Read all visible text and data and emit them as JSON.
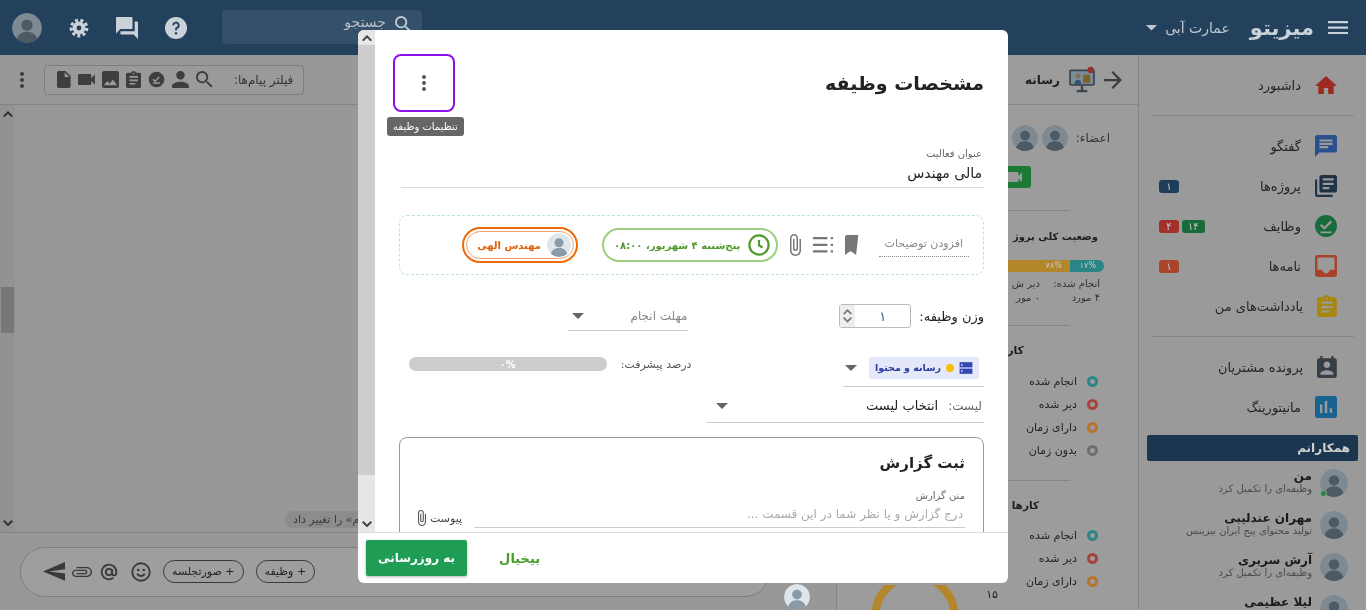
{
  "topbar": {
    "logo": "میزیتو",
    "workspace": "عمارت آبی",
    "search_placeholder": "جستجو"
  },
  "sidebar": {
    "groups": [
      [
        {
          "kind": "home",
          "label": "داشبورد"
        }
      ],
      [
        {
          "kind": "chat",
          "label": "گفتگو"
        },
        {
          "kind": "projects",
          "label": "پروژه‌ها",
          "badges": [
            {
              "text": "۱",
              "color": "#1e3d5a"
            }
          ]
        },
        {
          "kind": "tasks",
          "label": "وظایف",
          "badges": [
            {
              "text": "۱۴",
              "color": "#1a6b3c"
            },
            {
              "text": "۴",
              "color": "#a3302a"
            }
          ]
        },
        {
          "kind": "letters",
          "label": "نامه‌ها",
          "badges": [
            {
              "text": "۱",
              "color": "#a8452a"
            }
          ]
        },
        {
          "kind": "notes",
          "label": "یادداشت‌های من"
        }
      ],
      [
        {
          "kind": "customers",
          "label": "پرونده مشتریان"
        },
        {
          "kind": "monitoring",
          "label": "مانیتورینگ"
        }
      ]
    ],
    "colleagues_heading": "همکارانم",
    "colleagues": [
      {
        "name": "من",
        "status": "وظیفه‌ای را تکمیل کرد",
        "online": true
      },
      {
        "name": "مهران عندلیبی",
        "status": "تولید محتوای پیج ایران بیزینس",
        "online": false
      },
      {
        "name": "آرش سریری",
        "status": "وظیفه‌ای را تکمیل کرد",
        "online": false
      },
      {
        "name": "لیلا عظیمی",
        "online": false
      }
    ]
  },
  "project": {
    "title": "رسانه",
    "members_label": "اعضاء:",
    "status_heading": "وضعیت کلی پروژ",
    "progress": [
      {
        "label": "۱۷%",
        "color": "#2a8686"
      },
      {
        "label": "۷۸%",
        "color": "#b3862c"
      }
    ],
    "stats": [
      {
        "label": "انجام شده:",
        "value": "۴ مورد"
      },
      {
        "label": "دیر ش",
        "value": "۰ مور"
      }
    ],
    "sections": [
      {
        "heading": "کار",
        "legend": [
          {
            "label": "انجام شده",
            "color": "#2a8686"
          },
          {
            "label": "دیر شده",
            "color": "#a6423e"
          },
          {
            "label": "دارای زمان",
            "color": "#b8752a"
          },
          {
            "label": "بدون زمان",
            "color": "#6e6e6e"
          }
        ]
      },
      {
        "heading": "کارها",
        "legend": [
          {
            "label": "انجام شده",
            "color": "#2a8686"
          },
          {
            "label": "دیر شده",
            "color": "#a6423e"
          },
          {
            "label": "دارای زمان",
            "color": "#b8752a"
          }
        ],
        "count": "۱۵"
      }
    ]
  },
  "chat": {
    "filter_label": "فیلتر پیام‌ها:",
    "system_message": "م» را تغییر داد",
    "chips": [
      "+ وظیفه",
      "+ صورتجلسه"
    ]
  },
  "modal": {
    "title": "مشخصات وظیفه",
    "menu": {
      "focused": true,
      "tooltip": "تنظیمات وظیفه"
    },
    "activity": {
      "label": "عنوان فعالیت",
      "value": "مالی مهندس"
    },
    "description_placeholder": "افزودن توضیحات",
    "due_chip": "پنج‌شنبه ۴ شهریور، ۰۸:۰۰",
    "assignee": "مهندس الهی",
    "weight": {
      "label": "وزن وظیفه:",
      "value": "۱"
    },
    "deadline": {
      "placeholder": "مهلت انجام"
    },
    "category": "رسانه و محتوا",
    "progress": {
      "label": "درصد پیشرفت:",
      "text": "۰%",
      "level": 0
    },
    "list": {
      "label": "لیست:",
      "value": "انتخاب لیست"
    },
    "report": {
      "title": "ثبت گزارش",
      "label": "متن گزارش",
      "placeholder": "درج گزارش و یا نظر شما در این قسمت ...",
      "attach": "پیوست"
    },
    "buttons": {
      "primary": "به روزرسانی",
      "cancel": "بیخیال"
    }
  }
}
